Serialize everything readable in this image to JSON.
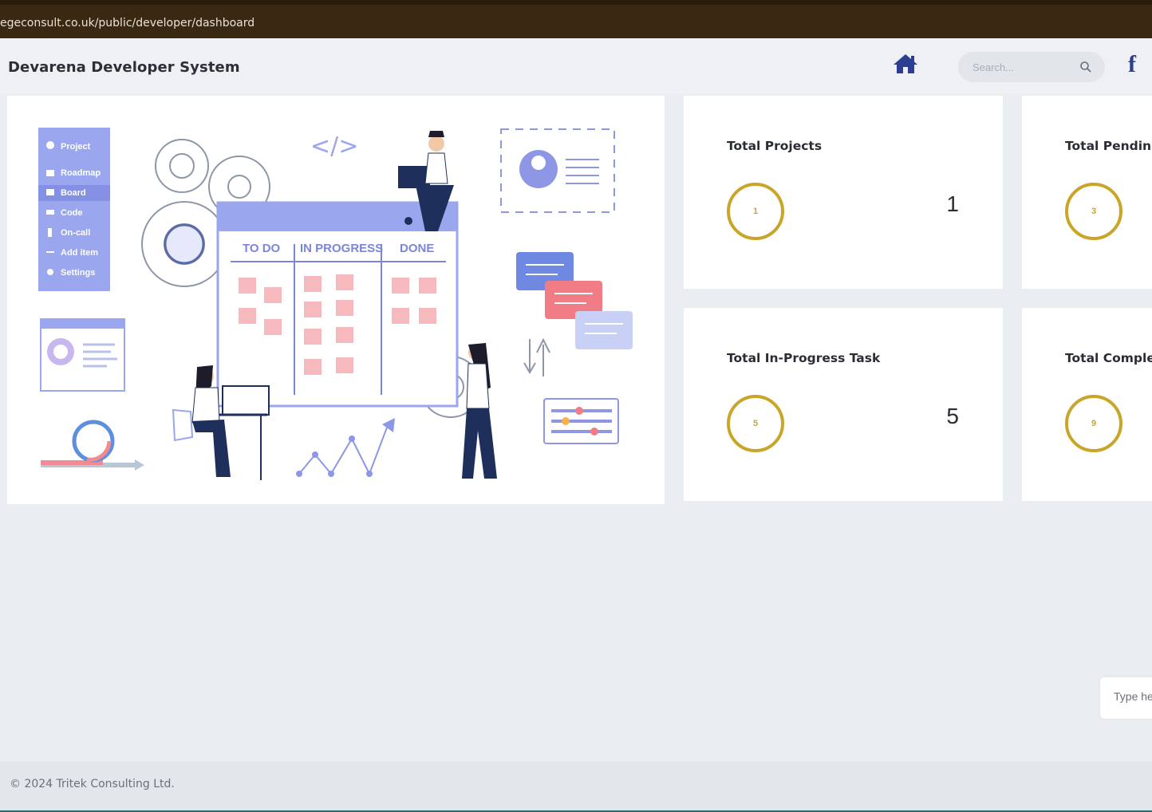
{
  "browser": {
    "url": "egeconsult.co.uk/public/developer/dashboard"
  },
  "header": {
    "brand": "Devarena Developer System",
    "search_placeholder": "Search...",
    "colors": {
      "accent": "#2c3e91"
    }
  },
  "hero": {
    "sidebar_items": [
      "Project",
      "Roadmap",
      "Board",
      "Code",
      "On-call",
      "Add item",
      "Settings"
    ],
    "board_columns": [
      "TO DO",
      "IN PROGRESS",
      "DONE"
    ],
    "code_symbol": "</>"
  },
  "cards": [
    {
      "label": "Total Projects",
      "badge": "1",
      "value": "1"
    },
    {
      "label": "Total Pending",
      "badge": "3"
    },
    {
      "label": "Total In-Progress Task",
      "badge": "5",
      "value": "5"
    },
    {
      "label": "Total Complete",
      "badge": "9"
    }
  ],
  "ring_color": "#c9a62a",
  "chat": {
    "placeholder": "Type he"
  },
  "footer": {
    "copyright": "© 2024 Tritek Consulting Ltd."
  }
}
